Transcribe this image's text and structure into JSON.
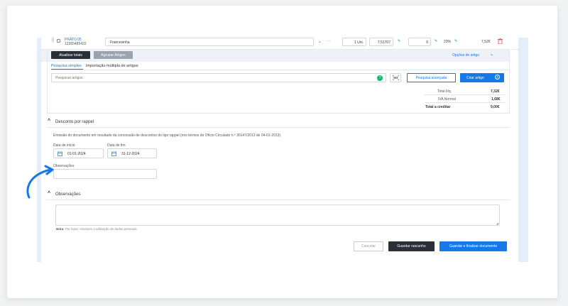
{
  "product_row": {
    "code": "PRATO.05",
    "barcode": "12365485422",
    "name": "Francesinha",
    "qty": "1 Uni.",
    "price": "7,51707",
    "discount_qty": "0",
    "vat": "23%",
    "total": "7,52€"
  },
  "toolbar": {
    "update_totals": "Atualizar totais",
    "group_articles": "Agrupar Artigos",
    "article_options": "Opções de artigo"
  },
  "tabs": [
    "Pesquisa simples",
    "Importação múltipla de artigos"
  ],
  "search": {
    "placeholder": "Pesquisar artigos",
    "advanced": "Pesquisa avançada",
    "create": "Criar artigo"
  },
  "totals": [
    {
      "label": "Total Ilíq.",
      "value": "7,32€"
    },
    {
      "label": "IVA Normal",
      "value": "1,68€"
    },
    {
      "label": "Total a creditar",
      "value": "9,00€"
    }
  ],
  "rappel": {
    "title": "Desconto por rappel",
    "description": "Emissão do documento em resultado da concessão de descontos do tipo rappel (nos termos do Ofício Circulado n.º 30147/2013 de 04-01-2013)",
    "start_label": "Data de início",
    "start_value": "01-01-2024",
    "end_label": "Data de fim",
    "end_value": "31-12-2024",
    "obs_label": "Observações",
    "obs_value": ""
  },
  "observations": {
    "title": "Observações",
    "value": "",
    "note_bold": "Nota:",
    "note": "Por favor, minimize a utilização de dados pessoais."
  },
  "footer": {
    "cancel": "Cancelar",
    "save_draft": "Guardar rascunho",
    "save_finish": "Guardar e finalizar documento"
  },
  "colors": {
    "accent": "#1478e6",
    "dark_button": "#2a2f38",
    "danger": "#e04646",
    "confirm": "#19b36b"
  }
}
